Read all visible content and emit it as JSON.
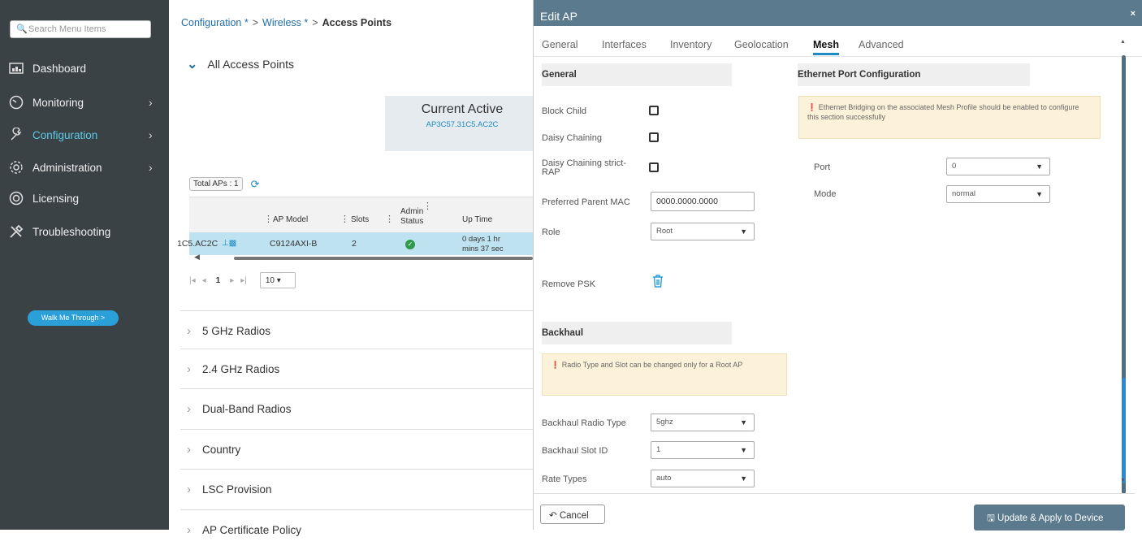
{
  "sidebar": {
    "search_placeholder": "Search Menu Items",
    "items": [
      {
        "label": "Dashboard",
        "icon": "dashboard-icon"
      },
      {
        "label": "Monitoring",
        "icon": "monitoring-icon"
      },
      {
        "label": "Configuration",
        "icon": "configuration-icon"
      },
      {
        "label": "Administration",
        "icon": "administration-icon"
      },
      {
        "label": "Licensing",
        "icon": "licensing-icon"
      },
      {
        "label": "Troubleshooting",
        "icon": "troubleshooting-icon"
      }
    ],
    "walk_me": "Walk Me Through >"
  },
  "breadcrumb": {
    "c1": "Configuration *",
    "c2": "Wireless *",
    "c3": "Access Points",
    "sep": ">"
  },
  "main": {
    "section_title": "All Access Points",
    "current_active": {
      "title": "Current Active",
      "sub": "AP3C57.31C5.AC2C"
    },
    "total_aps": "Total APs : 1",
    "table": {
      "headers": {
        "ap_model": "AP Model",
        "slots": "Slots",
        "admin_l1": "Admin",
        "admin_l2": "Status",
        "up_time": "Up Time"
      },
      "row": {
        "name": "1C5.AC2C",
        "model": "C9124AXI-B",
        "slots": "2",
        "uptime_l1": "0 days 1 hr",
        "uptime_l2": "mins 37 sec"
      }
    },
    "pager": {
      "page": "1",
      "size": "10"
    },
    "accordions": [
      "5 GHz Radios",
      "2.4 GHz Radios",
      "Dual-Band Radios",
      "Country",
      "LSC Provision",
      "AP Certificate Policy"
    ]
  },
  "drawer": {
    "title": "Edit AP",
    "close": "×",
    "tabs": [
      "General",
      "Interfaces",
      "Inventory",
      "Geolocation",
      "Mesh",
      "Advanced"
    ],
    "active_tab": "Mesh",
    "general": {
      "heading": "General",
      "block_child": "Block Child",
      "daisy_chaining": "Daisy Chaining",
      "daisy_strict_l1": "Daisy Chaining strict-",
      "daisy_strict_l2": "RAP",
      "preferred_parent_mac": "Preferred Parent MAC",
      "preferred_parent_mac_value": "0000.0000.0000",
      "role": "Role",
      "role_value": "Root",
      "remove_psk": "Remove PSK"
    },
    "ethernet": {
      "heading": "Ethernet Port Configuration",
      "alert": "Ethernet Bridging on the associated Mesh Profile should be enabled to configure this section successfully",
      "port": "Port",
      "port_value": "0",
      "mode": "Mode",
      "mode_value": "normal"
    },
    "backhaul": {
      "heading": "Backhaul",
      "alert": "Radio Type and Slot can be changed only for a Root AP",
      "radio_type": "Backhaul Radio Type",
      "radio_type_value": "5ghz",
      "slot_id": "Backhaul Slot ID",
      "slot_id_value": "1",
      "rate_types": "Rate Types",
      "rate_types_value": "auto"
    },
    "cancel": "Cancel",
    "update": "Update & Apply to Device"
  },
  "colors": {
    "sidebar_bg": "#3b4246",
    "accent": "#1e8bc3",
    "drawer_header": "#5b7a8e",
    "active_nav": "#5cc9e8"
  }
}
